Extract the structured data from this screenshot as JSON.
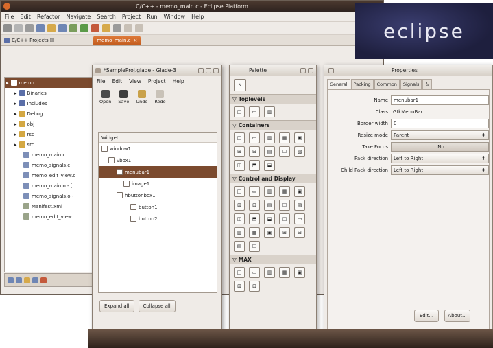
{
  "eclipse": {
    "title": "C/C++ - memo_main.c - Eclipse Platform",
    "menu": [
      "File",
      "Edit",
      "Refactor",
      "Navigate",
      "Search",
      "Project",
      "Run",
      "Window",
      "Help"
    ],
    "views": {
      "projects_tab": "C/C++ Projects ☒",
      "editor_tab": "memo_main.c"
    },
    "tree": [
      {
        "label": "memo",
        "selected": true,
        "icon_color": "#ffffff"
      },
      {
        "label": "Binaries",
        "selected": false,
        "icon_color": "#5b6fa8"
      },
      {
        "label": "Includes",
        "selected": false,
        "icon_color": "#5b6fa8"
      },
      {
        "label": "Debug",
        "selected": false,
        "icon_color": "#d4a843"
      },
      {
        "label": "obj",
        "selected": false,
        "icon_color": "#d4a843"
      },
      {
        "label": "rsc",
        "selected": false,
        "icon_color": "#d4a843"
      },
      {
        "label": "src",
        "selected": false,
        "icon_color": "#d4a843"
      },
      {
        "label": "memo_main.c",
        "selected": false,
        "icon_color": "#7d8fb8"
      },
      {
        "label": "memo_signals.c",
        "selected": false,
        "icon_color": "#7d8fb8"
      },
      {
        "label": "memo_edit_view.c",
        "selected": false,
        "icon_color": "#7d8fb8"
      },
      {
        "label": "memo_main.o - [",
        "selected": false,
        "icon_color": "#7d8fb8"
      },
      {
        "label": "memo_signals.o -",
        "selected": false,
        "icon_color": "#7d8fb8"
      },
      {
        "label": "Manifest.xml",
        "selected": false,
        "icon_color": "#9aa48a"
      },
      {
        "label": "memo_edit_view.",
        "selected": false,
        "icon_color": "#9aa48a"
      }
    ]
  },
  "logo": {
    "text": "eclipse"
  },
  "glade": {
    "title": "*SampleProj.glade - Glade-3",
    "menu": [
      "File",
      "Edit",
      "View",
      "Project",
      "Help"
    ],
    "tools": [
      {
        "label": "Open",
        "icon": "folder-icon",
        "color": "#4b4b4b"
      },
      {
        "label": "Save",
        "icon": "save-icon",
        "color": "#3e3e3e"
      },
      {
        "label": "Undo",
        "icon": "undo-icon",
        "color": "#c9a14a"
      },
      {
        "label": "Redo",
        "icon": "redo-icon",
        "color": "#c9c2b8"
      }
    ],
    "widget_header": "Widget",
    "widgets": [
      {
        "label": "window1",
        "indent": 4,
        "selected": false
      },
      {
        "label": "vbox1",
        "indent": 14,
        "selected": false
      },
      {
        "label": "menubar1",
        "indent": 26,
        "selected": true
      },
      {
        "label": "image1",
        "indent": 36,
        "selected": false
      },
      {
        "label": "hbuttonbox1",
        "indent": 26,
        "selected": false
      },
      {
        "label": "button1",
        "indent": 46,
        "selected": false
      },
      {
        "label": "button2",
        "indent": 46,
        "selected": false
      }
    ],
    "expand_all": "Expand all",
    "collapse_all": "Collapse all"
  },
  "palette": {
    "title": "Palette",
    "sections": [
      {
        "name": "Toplevels",
        "count": 3
      },
      {
        "name": "Containers",
        "count": 13
      },
      {
        "name": "Control and Display",
        "count": 22
      },
      {
        "name": "MAX",
        "count": 7
      }
    ]
  },
  "properties": {
    "title": "Properties",
    "tabs": [
      "General",
      "Packing",
      "Common",
      "Signals",
      "♿"
    ],
    "rows": [
      {
        "label": "Name",
        "value": "menubar1",
        "kind": "text"
      },
      {
        "label": "Class",
        "value": "GtkMenuBar",
        "kind": "plain"
      },
      {
        "label": "Border width",
        "value": "0",
        "kind": "text"
      },
      {
        "label": "Resize mode",
        "value": "Parent",
        "kind": "combo"
      },
      {
        "label": "Take Focus",
        "value": "No",
        "kind": "toggle"
      },
      {
        "label": "Pack direction",
        "value": "Left to Right",
        "kind": "combo"
      },
      {
        "label": "Child Pack direction",
        "value": "Left to Right",
        "kind": "combo"
      }
    ],
    "edit_button": "Edit...",
    "about_button": "About..."
  }
}
